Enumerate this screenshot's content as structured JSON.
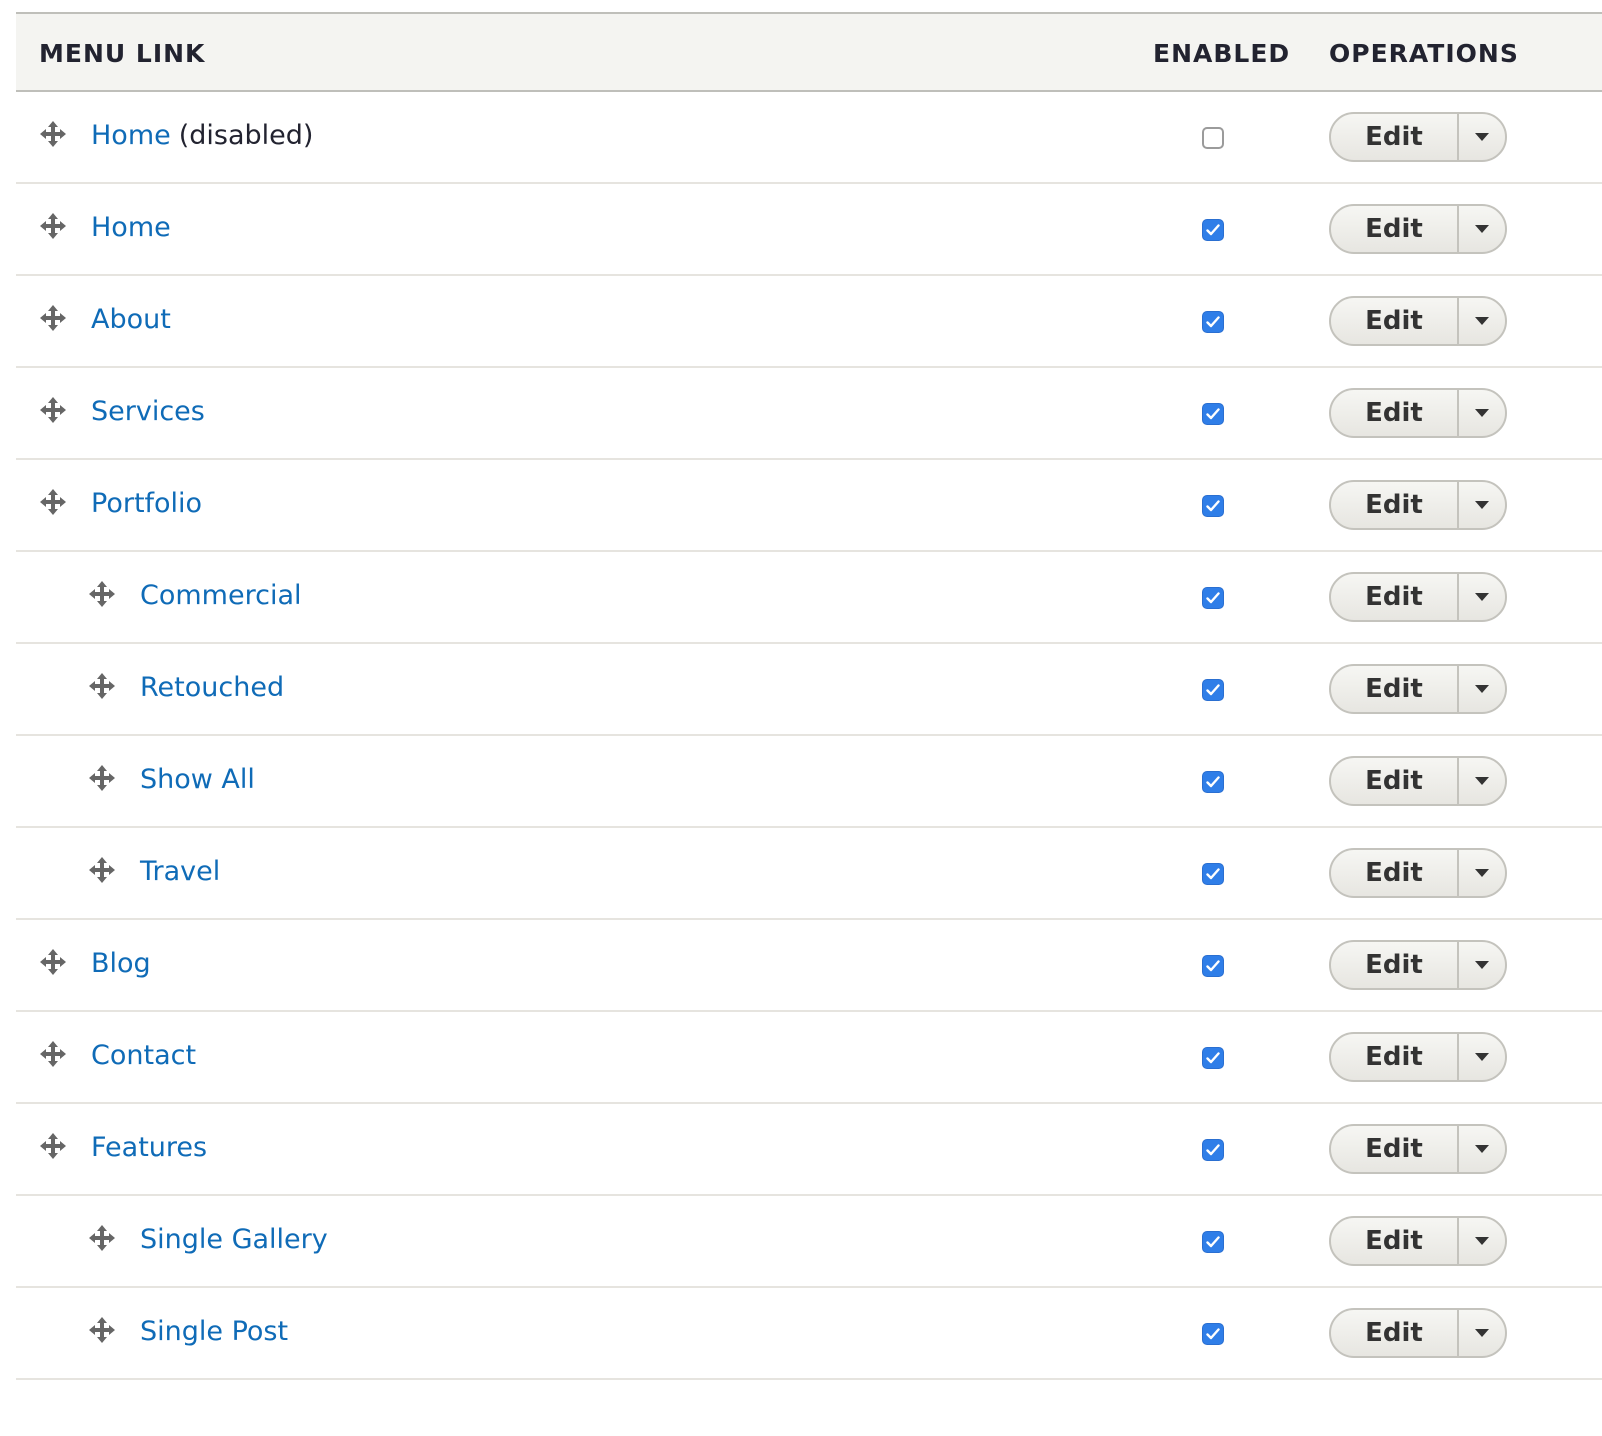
{
  "table": {
    "headers": {
      "menu_link": "MENU LINK",
      "enabled": "ENABLED",
      "operations": "OPERATIONS"
    },
    "rows": [
      {
        "label": "Home",
        "suffix": "(disabled)",
        "depth": 0,
        "enabled": false,
        "edit_label": "Edit"
      },
      {
        "label": "Home",
        "suffix": "",
        "depth": 0,
        "enabled": true,
        "edit_label": "Edit"
      },
      {
        "label": "About",
        "suffix": "",
        "depth": 0,
        "enabled": true,
        "edit_label": "Edit"
      },
      {
        "label": "Services",
        "suffix": "",
        "depth": 0,
        "enabled": true,
        "edit_label": "Edit"
      },
      {
        "label": "Portfolio",
        "suffix": "",
        "depth": 0,
        "enabled": true,
        "edit_label": "Edit"
      },
      {
        "label": "Commercial",
        "suffix": "",
        "depth": 1,
        "enabled": true,
        "edit_label": "Edit"
      },
      {
        "label": "Retouched",
        "suffix": "",
        "depth": 1,
        "enabled": true,
        "edit_label": "Edit"
      },
      {
        "label": "Show All",
        "suffix": "",
        "depth": 1,
        "enabled": true,
        "edit_label": "Edit"
      },
      {
        "label": "Travel",
        "suffix": "",
        "depth": 1,
        "enabled": true,
        "edit_label": "Edit"
      },
      {
        "label": "Blog",
        "suffix": "",
        "depth": 0,
        "enabled": true,
        "edit_label": "Edit"
      },
      {
        "label": "Contact",
        "suffix": "",
        "depth": 0,
        "enabled": true,
        "edit_label": "Edit"
      },
      {
        "label": "Features",
        "suffix": "",
        "depth": 0,
        "enabled": true,
        "edit_label": "Edit"
      },
      {
        "label": "Single Gallery",
        "suffix": "",
        "depth": 1,
        "enabled": true,
        "edit_label": "Edit"
      },
      {
        "label": "Single Post",
        "suffix": "",
        "depth": 1,
        "enabled": true,
        "edit_label": "Edit"
      }
    ]
  },
  "icons": {
    "drag_handle": "move-arrows-icon",
    "dropdown_toggle": "caret-down-icon",
    "checkbox_check": "checkmark-icon"
  },
  "colors": {
    "link": "#0f6bb7",
    "header_bg": "#f4f4f1",
    "checkbox_on": "#2f7ee8"
  }
}
